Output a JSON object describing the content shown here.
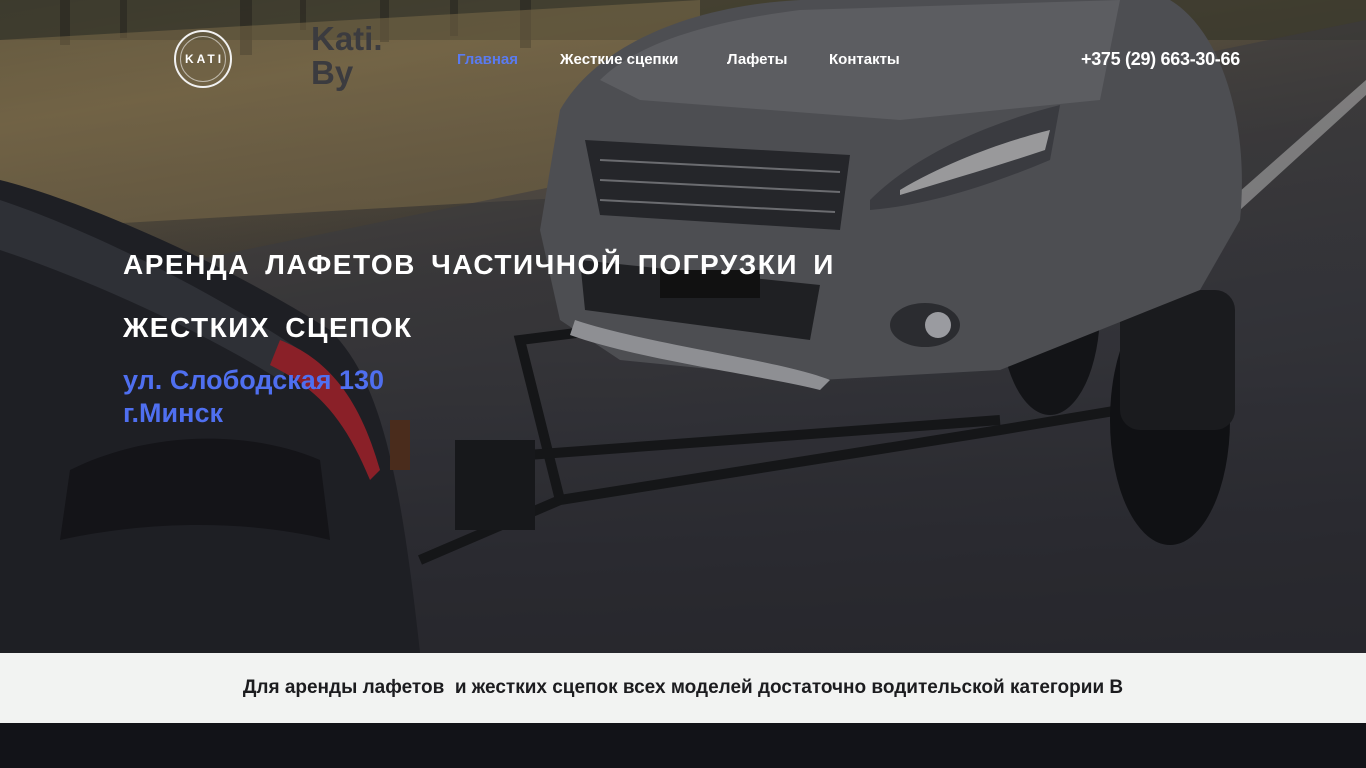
{
  "header": {
    "logo_text": "KATI",
    "brand_line1": "Kati.",
    "brand_line2": "By",
    "nav": [
      {
        "label": "Главная",
        "active": true
      },
      {
        "label": "Жесткие сцепки",
        "active": false
      },
      {
        "label": "Лафеты",
        "active": false
      },
      {
        "label": "Контакты",
        "active": false
      }
    ],
    "phone": "+375 (29) 663-30-66"
  },
  "hero": {
    "headline_line1": "АРЕНДА ЛАФЕТОВ ЧАСТИЧНОЙ ПОГРУЗКИ И",
    "headline_line2": "ЖЕСТКИХ СЦЕПОК",
    "address_line1": "ул. Слободская 130",
    "address_line2": "г.Минск"
  },
  "strip": {
    "text": "Для аренды лафетов  и жестких сцепок всех моделей достаточно водительской категории B"
  },
  "colors": {
    "accent": "#4f6ff0",
    "nav_active": "#5a7bf0",
    "strip_bg": "#f2f3f2",
    "footer_bg": "#121318"
  }
}
